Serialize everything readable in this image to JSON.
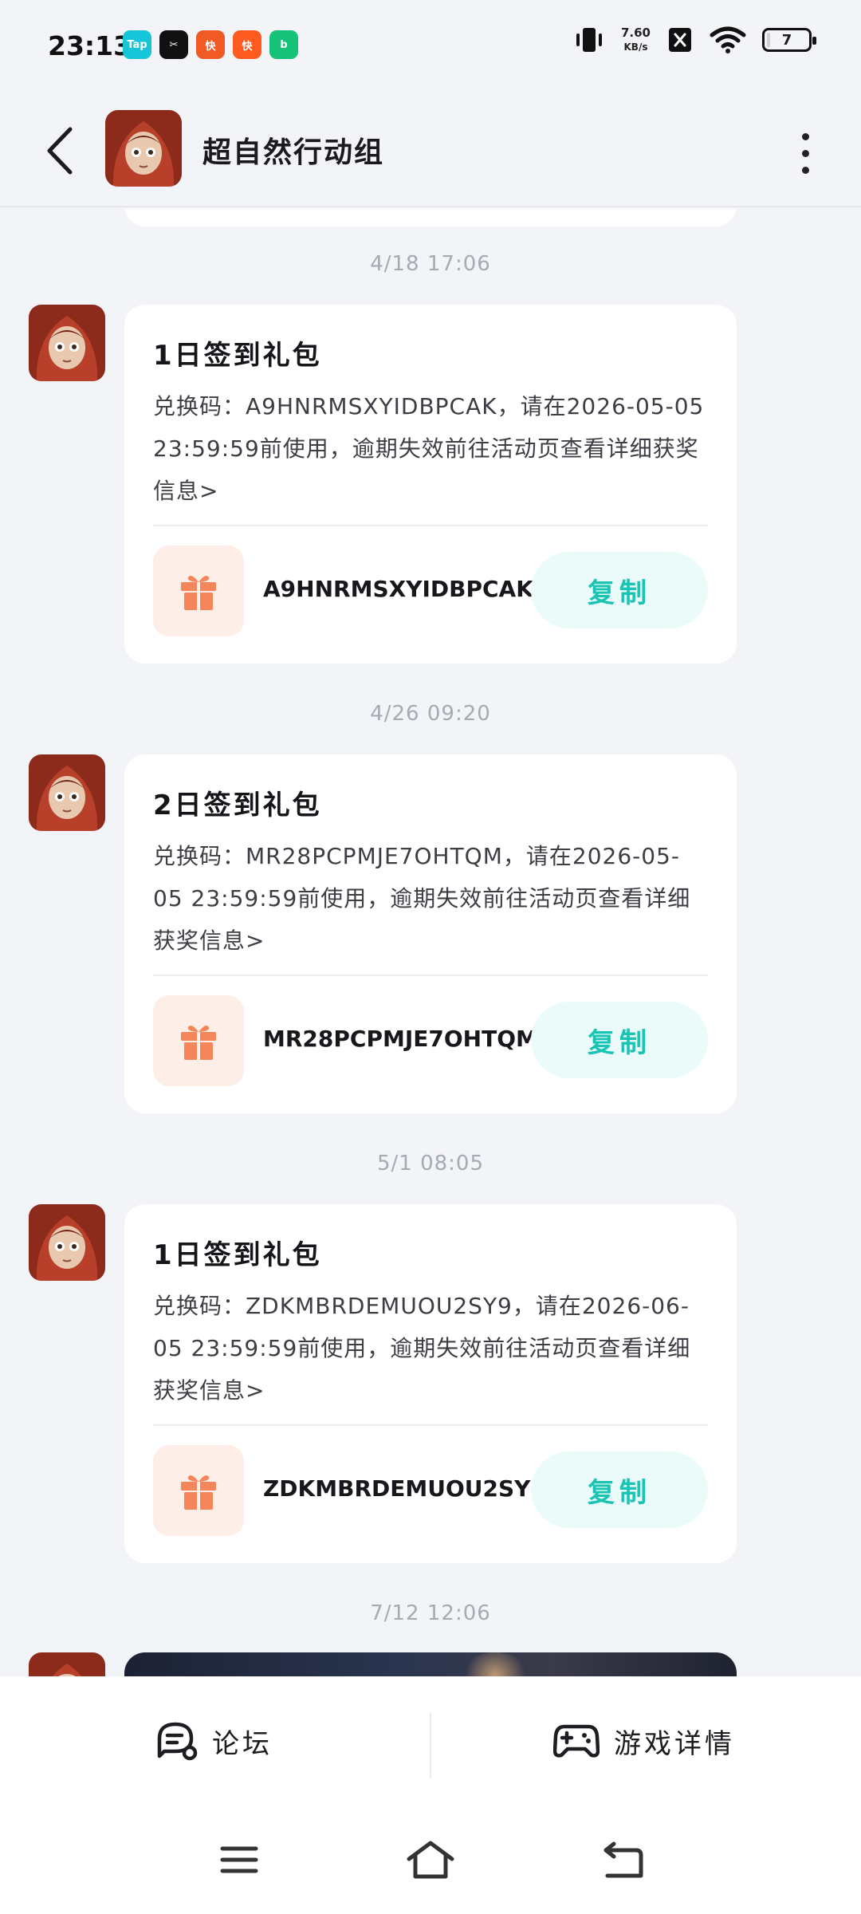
{
  "status_bar": {
    "time": "23:13",
    "apps": [
      {
        "name": "taptap-icon",
        "label": "Tap",
        "color": "#16c6d8"
      },
      {
        "name": "capcut-icon",
        "label": "✂",
        "color": "#111111"
      },
      {
        "name": "kuaishou-jisu-icon",
        "label": "快",
        "color": "#f05a24"
      },
      {
        "name": "kuaishou-icon",
        "label": "快",
        "color": "#ff5a1f"
      },
      {
        "name": "b-app-icon",
        "label": "b",
        "color": "#16c27a"
      }
    ],
    "net_speed_value": "7.60",
    "net_speed_unit": "KB/s",
    "battery_level": "7"
  },
  "header": {
    "title": "超自然行动组"
  },
  "messages": [
    {
      "timestamp": "4/18   17:06",
      "title": "1日签到礼包",
      "body": "兑换码：A9HNRMSXYIDBPCAK，请在2026-05-05 23:59:59前使用，逾期失效前往活动页查看详细获奖信息>",
      "code": "A9HNRMSXYIDBPCAK",
      "copy_label": "复制"
    },
    {
      "timestamp": "4/26   09:20",
      "title": "2日签到礼包",
      "body": "兑换码：MR28PCPMJE7OHTQM，请在2026-05-05 23:59:59前使用，逾期失效前往活动页查看详细获奖信息>",
      "code": "MR28PCPMJE7OHTQM",
      "copy_label": "复制"
    },
    {
      "timestamp": "5/1   08:05",
      "title": "1日签到礼包",
      "body": "兑换码：ZDKMBRDEMUOU2SY9，请在2026-06-05 23:59:59前使用，逾期失效前往活动页查看详细获奖信息>",
      "code": "ZDKMBRDEMUOU2SY9",
      "copy_label": "复制"
    },
    {
      "timestamp": "7/12   12:06"
    }
  ],
  "bottom_bar": {
    "forum_label": "论坛",
    "game_details_label": "游戏详情"
  },
  "colors": {
    "accent": "#19c4b5",
    "gift": "#f5855a",
    "background": "#f3f4f8"
  }
}
